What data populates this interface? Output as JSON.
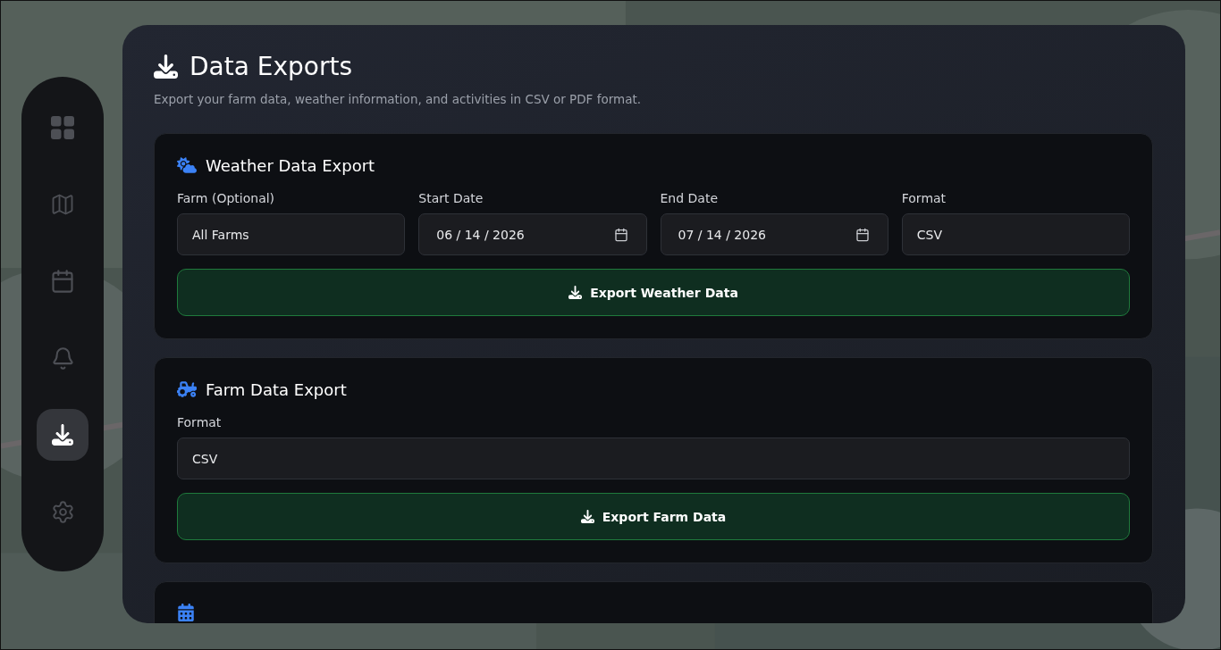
{
  "sidebar": {
    "items": [
      {
        "selected": false
      },
      {
        "selected": false
      },
      {
        "selected": false
      },
      {
        "selected": false
      },
      {
        "selected": true
      },
      {
        "selected": false
      }
    ]
  },
  "header": {
    "title": "Data Exports",
    "subtitle": "Export your farm data, weather information, and activities in CSV or PDF format."
  },
  "sections": [
    {
      "kind": "weather",
      "title": "Weather Data Export",
      "fields": [
        {
          "kind": "select",
          "label": "Farm (Optional)",
          "value": "All Farms"
        },
        {
          "kind": "date",
          "label": "Start Date",
          "value": "06 / 14 / 2026"
        },
        {
          "kind": "date",
          "label": "End Date",
          "value": "07 / 14 / 2026"
        },
        {
          "kind": "select",
          "label": "Format",
          "value": "CSV"
        }
      ],
      "button": "Export Weather Data"
    },
    {
      "kind": "farm",
      "title": "Farm Data Export",
      "fields": [
        {
          "kind": "select",
          "label": "Format",
          "value": "CSV"
        }
      ],
      "button": "Export Farm Data"
    },
    {
      "kind": "activity"
    }
  ]
}
